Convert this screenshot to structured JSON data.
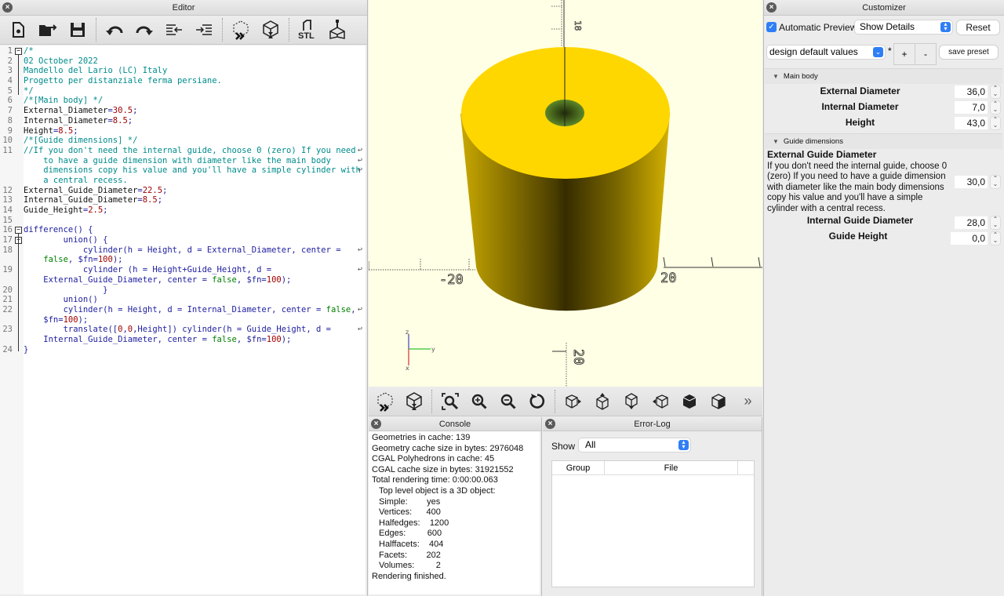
{
  "editor": {
    "title": "Editor",
    "toolbar": [
      "new-file",
      "open-file",
      "save-file",
      "undo",
      "redo",
      "unindent",
      "indent",
      "preview",
      "render",
      "export-stl",
      "send-to-print"
    ],
    "toolbar_stl_label": "STL",
    "lines": [
      {
        "n": "1",
        "fold": "minus",
        "parts": [
          [
            "c-com",
            "/*"
          ]
        ]
      },
      {
        "n": "2",
        "parts": [
          [
            "c-com",
            "02 October 2022"
          ]
        ]
      },
      {
        "n": "3",
        "parts": [
          [
            "c-com",
            "Mandello del Lario (LC) Italy"
          ]
        ]
      },
      {
        "n": "4",
        "parts": [
          [
            "c-com",
            "Progetto per distanziale ferma persiane."
          ]
        ]
      },
      {
        "n": "5",
        "parts": [
          [
            "c-com",
            "*/"
          ]
        ]
      },
      {
        "n": "6",
        "parts": [
          [
            "c-com",
            "/*[Main body] */"
          ]
        ]
      },
      {
        "n": "7",
        "parts": [
          [
            "c-txt",
            "External_Diameter"
          ],
          [
            "c-kw",
            "="
          ],
          [
            "c-num",
            "30.5"
          ],
          [
            "c-kw",
            ";"
          ]
        ]
      },
      {
        "n": "8",
        "parts": [
          [
            "c-txt",
            "Internal_Diameter"
          ],
          [
            "c-kw",
            "="
          ],
          [
            "c-num",
            "8.5"
          ],
          [
            "c-kw",
            ";"
          ]
        ]
      },
      {
        "n": "9",
        "parts": [
          [
            "c-txt",
            "Height"
          ],
          [
            "c-kw",
            "="
          ],
          [
            "c-num",
            "8.5"
          ],
          [
            "c-kw",
            ";"
          ]
        ]
      },
      {
        "n": "10",
        "parts": [
          [
            "c-com",
            "/*[Guide dimensions] */"
          ]
        ]
      },
      {
        "n": "11",
        "wrap": true,
        "parts": [
          [
            "c-com",
            "//If you don't need the internal guide, choose 0 (zero) If you need"
          ]
        ]
      },
      {
        "n": "",
        "wrap": true,
        "parts": [
          [
            "c-com",
            "    to have a guide dimension with diameter like the main body"
          ]
        ]
      },
      {
        "n": "",
        "wrap": true,
        "parts": [
          [
            "c-com",
            "    dimensions copy his value and you'll have a simple cylinder with"
          ]
        ]
      },
      {
        "n": "",
        "parts": [
          [
            "c-com",
            "    a central recess."
          ]
        ]
      },
      {
        "n": "12",
        "parts": [
          [
            "c-txt",
            "External_Guide_Diameter"
          ],
          [
            "c-kw",
            "="
          ],
          [
            "c-num",
            "22.5"
          ],
          [
            "c-kw",
            ";"
          ]
        ]
      },
      {
        "n": "13",
        "parts": [
          [
            "c-txt",
            "Internal_Guide_Diameter"
          ],
          [
            "c-kw",
            "="
          ],
          [
            "c-num",
            "8.5"
          ],
          [
            "c-kw",
            ";"
          ]
        ]
      },
      {
        "n": "14",
        "parts": [
          [
            "c-txt",
            "Guide_Height"
          ],
          [
            "c-kw",
            "="
          ],
          [
            "c-num",
            "2.5"
          ],
          [
            "c-kw",
            ";"
          ]
        ]
      },
      {
        "n": "15",
        "parts": []
      },
      {
        "n": "16",
        "fold": "minus",
        "parts": [
          [
            "c-kw",
            "difference() {"
          ]
        ]
      },
      {
        "n": "17",
        "fold": "minus",
        "parts": [
          [
            "c-kw",
            "        union() {"
          ]
        ]
      },
      {
        "n": "18",
        "wrap": true,
        "parts": [
          [
            "c-kw",
            "            cylinder(h = Height, d = External_Diameter, center ="
          ]
        ]
      },
      {
        "n": "",
        "parts": [
          [
            "c-bool",
            "    false"
          ],
          [
            "c-kw",
            ", $fn="
          ],
          [
            "c-num",
            "100"
          ],
          [
            "c-kw",
            ");"
          ]
        ]
      },
      {
        "n": "19",
        "wrap": true,
        "parts": [
          [
            "c-kw",
            "            cylinder (h = Height+Guide_Height, d ="
          ]
        ]
      },
      {
        "n": "",
        "parts": [
          [
            "c-kw",
            "    External_Guide_Diameter, center = "
          ],
          [
            "c-bool",
            "false"
          ],
          [
            "c-kw",
            ", $fn="
          ],
          [
            "c-num",
            "100"
          ],
          [
            "c-kw",
            ");"
          ]
        ]
      },
      {
        "n": "20",
        "parts": [
          [
            "c-kw",
            "                }"
          ]
        ]
      },
      {
        "n": "21",
        "parts": [
          [
            "c-kw",
            "        union()"
          ]
        ]
      },
      {
        "n": "22",
        "wrap": true,
        "parts": [
          [
            "c-kw",
            "        cylinder(h = Height, d = Internal_Diameter, center = "
          ],
          [
            "c-bool",
            "false"
          ],
          [
            "c-kw",
            ","
          ]
        ]
      },
      {
        "n": "",
        "parts": [
          [
            "c-kw",
            "    $fn="
          ],
          [
            "c-num",
            "100"
          ],
          [
            "c-kw",
            ");"
          ]
        ]
      },
      {
        "n": "23",
        "wrap": true,
        "parts": [
          [
            "c-kw",
            "        translate(["
          ],
          [
            "c-num",
            "0"
          ],
          [
            "c-kw",
            ","
          ],
          [
            "c-num",
            "0"
          ],
          [
            "c-kw",
            ",Height]) cylinder(h = Guide_Height, d ="
          ]
        ]
      },
      {
        "n": "",
        "parts": [
          [
            "c-kw",
            "    Internal_Guide_Diameter, center = "
          ],
          [
            "c-bool",
            "false"
          ],
          [
            "c-kw",
            ", $fn="
          ],
          [
            "c-num",
            "100"
          ],
          [
            "c-kw",
            ");"
          ]
        ]
      },
      {
        "n": "24",
        "parts": [
          [
            "c-kw",
            "}"
          ]
        ]
      }
    ]
  },
  "viewport": {
    "axis_labels": {
      "left": "-20",
      "right": "20",
      "bottom": "20",
      "top": "18"
    },
    "gizmo": {
      "x": "x",
      "y": "y",
      "z": "z"
    },
    "colors": {
      "background": "#ffffe5",
      "body_top": "#ffd700",
      "body_side_light": "#c9a800",
      "body_side_dark": "#3a3000",
      "hole": "#5f8a2a"
    },
    "toolbar": [
      "preview",
      "render",
      "view-all",
      "zoom-in",
      "zoom-out",
      "reset-view",
      "view-right",
      "view-top",
      "view-bottom",
      "view-left",
      "view-front",
      "view-back",
      "more"
    ]
  },
  "console": {
    "title": "Console",
    "lines": [
      {
        "text": "Geometries in cache: 139",
        "indent": false
      },
      {
        "text": "Geometry cache size in bytes: 2976048",
        "indent": false
      },
      {
        "text": "CGAL Polyhedrons in cache: 45",
        "indent": false
      },
      {
        "text": "CGAL cache size in bytes: 31921552",
        "indent": false
      },
      {
        "text": "Total rendering time: 0:00:00.063",
        "indent": false
      },
      {
        "text": "Top level object is a 3D object:",
        "indent": true
      },
      {
        "text": "Simple:        yes",
        "indent": true
      },
      {
        "text": "Vertices:      400",
        "indent": true
      },
      {
        "text": "Halfedges:    1200",
        "indent": true
      },
      {
        "text": "Edges:         600",
        "indent": true
      },
      {
        "text": "Halffacets:    404",
        "indent": true
      },
      {
        "text": "Facets:        202",
        "indent": true
      },
      {
        "text": "Volumes:         2",
        "indent": true
      },
      {
        "text": "Rendering finished.",
        "indent": false
      }
    ]
  },
  "errorlog": {
    "title": "Error-Log",
    "show_label": "Show",
    "show_value": "All",
    "columns": [
      "Group",
      "File"
    ]
  },
  "customizer": {
    "title": "Customizer",
    "auto_preview_label": "Automatic Preview",
    "auto_preview_checked": true,
    "details_select": "Show Details",
    "reset_label": "Reset",
    "preset_select": "design default values",
    "preset_modified": "*",
    "plus_label": "+",
    "minus_label": "-",
    "save_preset_label": "save preset",
    "accent": "#2f7ef6",
    "groups": [
      {
        "name": "Main body",
        "params": [
          {
            "label": "External Diameter",
            "value": "36,0"
          },
          {
            "label": "Internal Diameter",
            "value": "7,0"
          },
          {
            "label": "Height",
            "value": "43,0"
          }
        ]
      },
      {
        "name": "Guide dimensions",
        "params": [
          {
            "label": "External Guide Diameter",
            "description": "If you don't need the internal guide, choose 0 (zero) If you need to have a guide dimension with diameter like the main body dimensions copy his value and you'll have a simple cylinder with a central recess.",
            "value": "30,0"
          },
          {
            "label": "Internal Guide Diameter",
            "value": "28,0"
          },
          {
            "label": "Guide Height",
            "value": "0,0"
          }
        ]
      }
    ]
  }
}
